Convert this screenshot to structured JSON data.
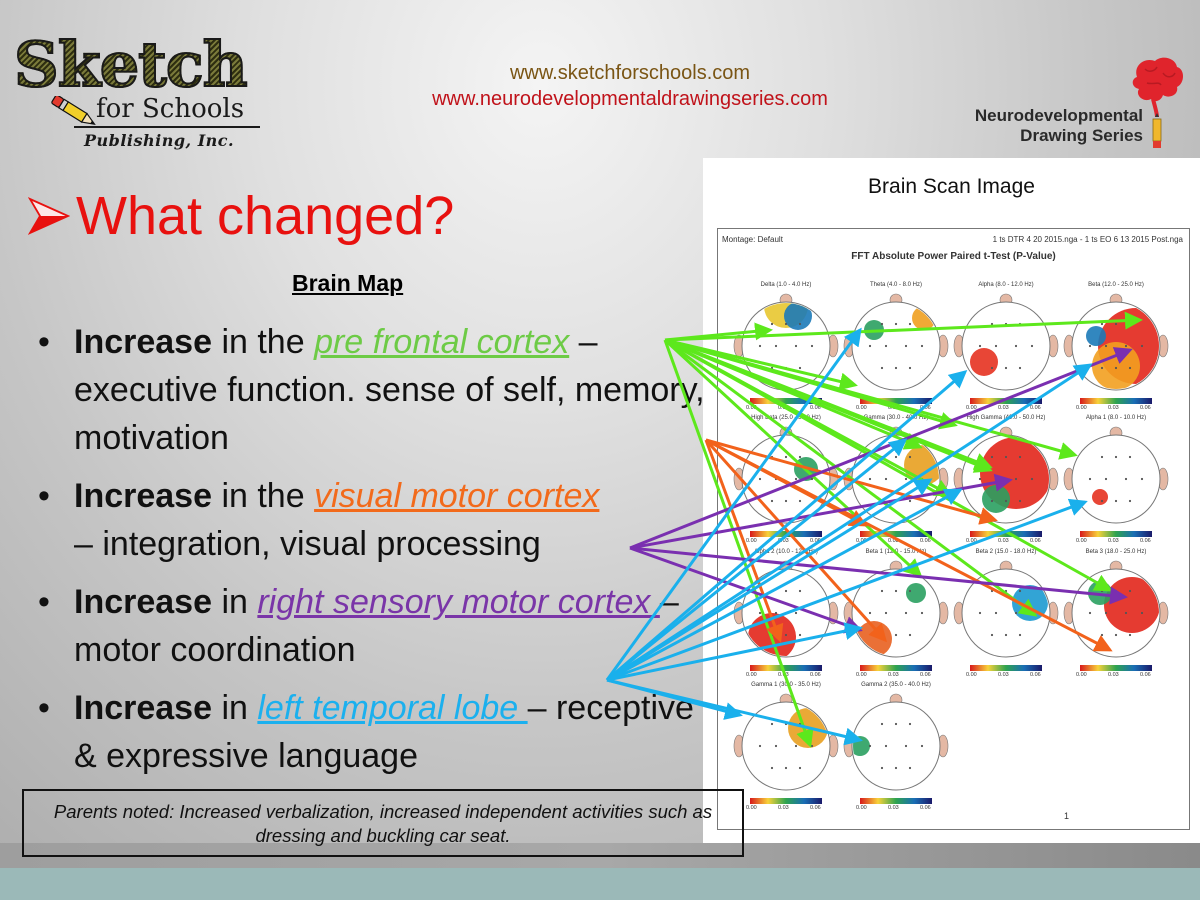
{
  "header": {
    "logo_left": {
      "brand": "Sketch",
      "sub": "for Schools",
      "tagline": "Publishing, Inc."
    },
    "urls": [
      "www.sketchforschools.com",
      "www.neurodevelopmentaldrawingseries.com"
    ],
    "logo_right": {
      "line1": "Neurodevelopmental",
      "line2": "Drawing Series"
    }
  },
  "slide": {
    "title": "What changed?",
    "subtitle": "Brain Map",
    "bullets": [
      {
        "lead": "Increase",
        "pre": " in the ",
        "highlight": "pre frontal cortex",
        "highlight_color": "green",
        "post": " – executive function. sense of self, memory, motivation"
      },
      {
        "lead": "Increase",
        "pre": " in the ",
        "highlight": "visual motor cortex",
        "highlight_color": "orange",
        "post": " – integration, visual processing"
      },
      {
        "lead": "Increase",
        "pre": " in ",
        "highlight": "right sensory motor cortex ",
        "highlight_color": "purple",
        "post": "– motor coordination"
      },
      {
        "lead": "Increase",
        "pre": " in ",
        "highlight": "left temporal lobe ",
        "highlight_color": "blue",
        "post": "– receptive & expressive language"
      }
    ],
    "notes": "Parents noted:  Increased verbalization, increased independent activities such as dressing and buckling car seat."
  },
  "colors": {
    "title": "#e8110f",
    "green": "#5de81c",
    "orange": "#f2621b",
    "purple": "#7a2fb0",
    "blue": "#1ab0ec",
    "teal_band": "#9bb9b8"
  },
  "scan": {
    "panel_title": "Brain Scan Image",
    "montage": "Montage:  Default",
    "files": "1 ts DTR 4 20 2015.nga - 1 ts EO 6 13 2015 Post.nga",
    "heading": "FFT Absolute Power Paired t-Test  (P-Value)",
    "page": "1",
    "scale_ticks": [
      "0.00",
      "0.03",
      "0.06"
    ],
    "maps": [
      "Delta (1.0 - 4.0 Hz)",
      "Theta (4.0 - 8.0 Hz)",
      "Alpha (8.0 - 12.0 Hz)",
      "Beta (12.0 - 25.0 Hz)",
      "High Beta (25.0 - 30.0 Hz)",
      "Gamma (30.0 - 40.0 Hz)",
      "High Gamma (40.0 - 50.0 Hz)",
      "Alpha 1 (8.0 - 10.0 Hz)",
      "Alpha 2 (10.0 - 12.0 Hz)",
      "Beta 1 (12.0 - 15.0 Hz)",
      "Beta 2 (15.0 - 18.0 Hz)",
      "Beta 3 (18.0 - 25.0 Hz)",
      "Gamma 1 (30.0 - 35.0 Hz)",
      "Gamma 2 (35.0 - 40.0 Hz)"
    ]
  }
}
